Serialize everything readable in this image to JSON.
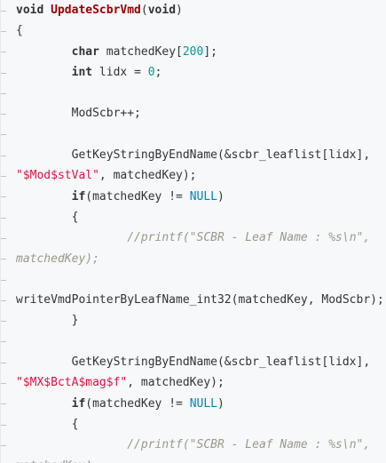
{
  "code": {
    "lines": [
      [
        {
          "t": "kw",
          "s": "void"
        },
        {
          "t": "p",
          "s": " "
        },
        {
          "t": "fn",
          "s": "UpdateScbrVmd"
        },
        {
          "t": "p",
          "s": "("
        },
        {
          "t": "kw",
          "s": "void"
        },
        {
          "t": "p",
          "s": ")"
        }
      ],
      [
        {
          "t": "p",
          "s": "{"
        }
      ],
      [
        {
          "t": "p",
          "s": "        "
        },
        {
          "t": "kw",
          "s": "char"
        },
        {
          "t": "p",
          "s": " matchedKey["
        },
        {
          "t": "num",
          "s": "200"
        },
        {
          "t": "p",
          "s": "];"
        }
      ],
      [
        {
          "t": "p",
          "s": "        "
        },
        {
          "t": "kw",
          "s": "int"
        },
        {
          "t": "p",
          "s": " lidx = "
        },
        {
          "t": "num",
          "s": "0"
        },
        {
          "t": "p",
          "s": ";"
        }
      ],
      [],
      [
        {
          "t": "p",
          "s": "        ModScbr++;"
        }
      ],
      [],
      [
        {
          "t": "p",
          "s": "        GetKeyStringByEndName(&scbr_leaflist[lidx],"
        }
      ],
      [
        {
          "t": "str",
          "s": "\"$Mod$stVal\""
        },
        {
          "t": "p",
          "s": ", matchedKey);"
        }
      ],
      [
        {
          "t": "p",
          "s": "        "
        },
        {
          "t": "kw",
          "s": "if"
        },
        {
          "t": "p",
          "s": "(matchedKey != "
        },
        {
          "t": "nul",
          "s": "NULL"
        },
        {
          "t": "p",
          "s": ")"
        }
      ],
      [
        {
          "t": "p",
          "s": "        {"
        }
      ],
      [
        {
          "t": "p",
          "s": "                "
        },
        {
          "t": "cm",
          "s": "//printf(\"SCBR - Leaf Name : %s\\n\","
        }
      ],
      [
        {
          "t": "cm",
          "s": "matchedKey);"
        }
      ],
      [],
      [
        {
          "t": "p",
          "s": "writeVmdPointerByLeafName_int32(matchedKey, ModScbr);"
        }
      ],
      [
        {
          "t": "p",
          "s": "        }"
        }
      ],
      [],
      [
        {
          "t": "p",
          "s": "        GetKeyStringByEndName(&scbr_leaflist[lidx],"
        }
      ],
      [
        {
          "t": "str",
          "s": "\"$MX$BctA$mag$f\""
        },
        {
          "t": "p",
          "s": ", matchedKey);"
        }
      ],
      [
        {
          "t": "p",
          "s": "        "
        },
        {
          "t": "kw",
          "s": "if"
        },
        {
          "t": "p",
          "s": "(matchedKey != "
        },
        {
          "t": "nul",
          "s": "NULL"
        },
        {
          "t": "p",
          "s": ")"
        }
      ],
      [
        {
          "t": "p",
          "s": "        {"
        }
      ],
      [
        {
          "t": "p",
          "s": "                "
        },
        {
          "t": "cm",
          "s": "//printf(\"SCBR - Leaf Name : %s\\n\","
        }
      ],
      [
        {
          "t": "cm",
          "s": "matchedKey);"
        }
      ]
    ]
  },
  "colors": {
    "background": "#f6f8fa",
    "keyword": "#333333",
    "function_name": "#990000",
    "number": "#009999",
    "string": "#dd1144",
    "null_constant": "#0086b3",
    "comment": "#999988"
  }
}
